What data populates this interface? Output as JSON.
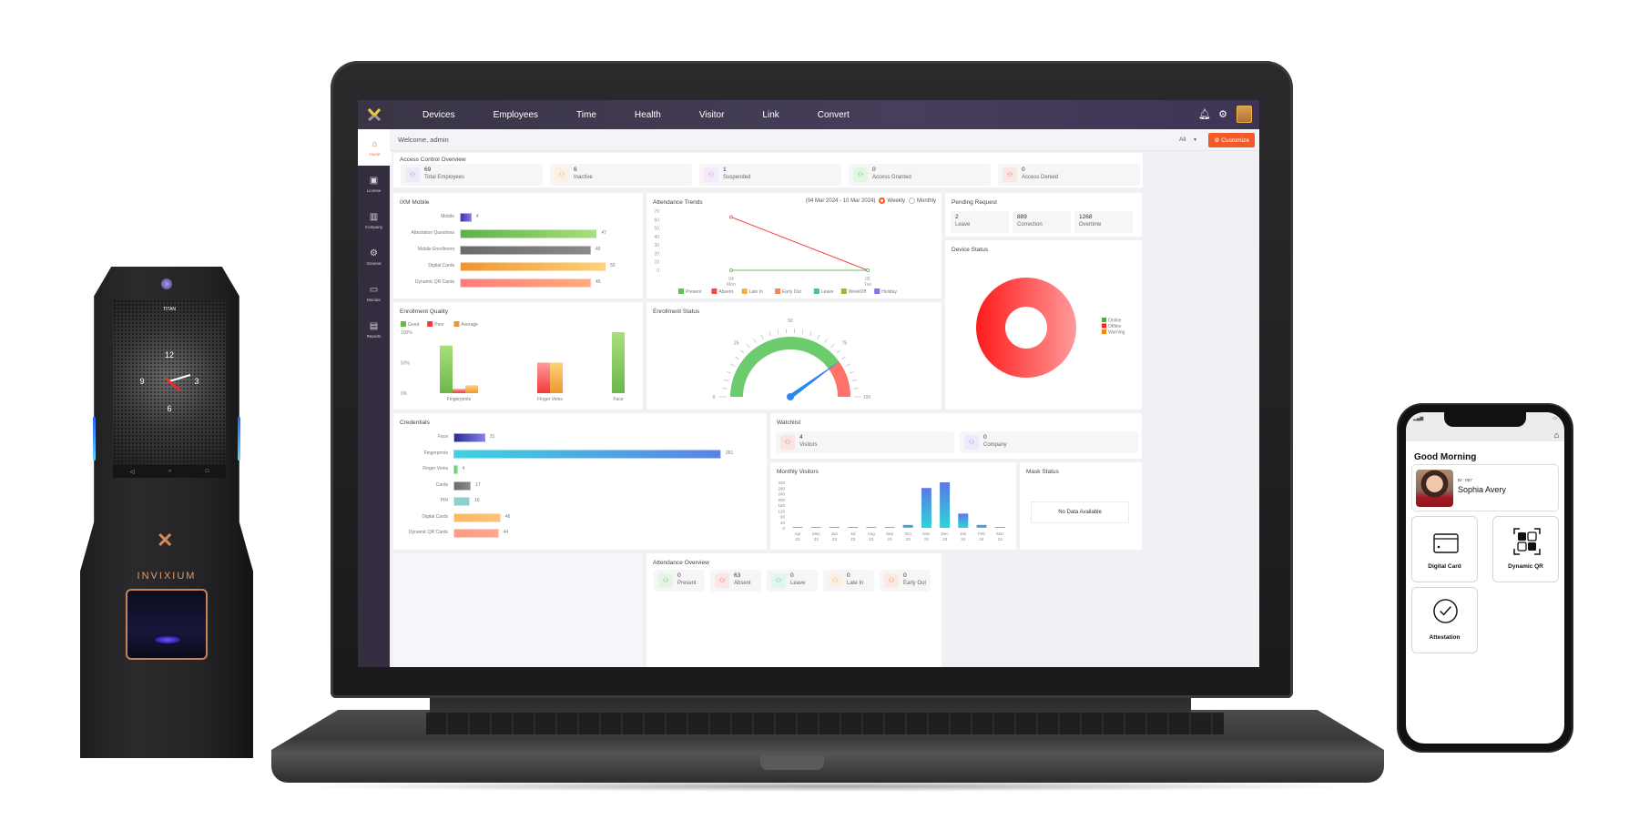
{
  "device": {
    "screen_title": "TITAN",
    "brand": "INVIXIUM",
    "clock_numbers": [
      "12",
      "3",
      "6",
      "9"
    ]
  },
  "app": {
    "nav": {
      "items": [
        "Devices",
        "Employees",
        "Time",
        "Health",
        "Visitor",
        "Link",
        "Convert"
      ],
      "icons": [
        "bell-icon",
        "gear-icon",
        "avatar"
      ]
    },
    "sidebar": {
      "items": [
        {
          "label": "Home",
          "icon": "home-icon",
          "glyph": "⌂",
          "active": true
        },
        {
          "label": "License",
          "icon": "license-icon",
          "glyph": "▣"
        },
        {
          "label": "Company",
          "icon": "company-icon",
          "glyph": "▥"
        },
        {
          "label": "General",
          "icon": "gear-icon",
          "glyph": "⚙"
        },
        {
          "label": "Monitor",
          "icon": "monitor-icon",
          "glyph": "▭"
        },
        {
          "label": "Reports",
          "icon": "reports-icon",
          "glyph": "▤"
        }
      ]
    },
    "header": {
      "welcome": "Welcome, admin",
      "filter_value": "All",
      "customize_label": "Customize"
    },
    "access_control": {
      "title": "Access Control Overview",
      "stats": [
        {
          "value": "69",
          "label": "Total Employees",
          "color": "#8e7cf0",
          "bg": "#ecebfb"
        },
        {
          "value": "6",
          "label": "Inactive",
          "color": "#f2a04a",
          "bg": "#fdf0e2"
        },
        {
          "value": "1",
          "label": "Suspended",
          "color": "#c47be0",
          "bg": "#f6e9fb"
        },
        {
          "value": "0",
          "label": "Access Granted",
          "color": "#4cb85a",
          "bg": "#e3f6e4"
        },
        {
          "value": "0",
          "label": "Access Denied",
          "color": "#ee5a5a",
          "bg": "#fde5e5"
        }
      ]
    },
    "pending_request": {
      "title": "Pending Request",
      "items": [
        {
          "value": "2",
          "label": "Leave"
        },
        {
          "value": "889",
          "label": "Correction"
        },
        {
          "value": "1268",
          "label": "Overtime"
        }
      ]
    },
    "watchlist": {
      "title": "Watchlist",
      "items": [
        {
          "value": "4",
          "label": "Visitors",
          "color": "#ee6a6a",
          "bg": "#fde2e2"
        },
        {
          "value": "0",
          "label": "Company",
          "color": "#8e7cf0",
          "bg": "#ecebfb"
        }
      ]
    },
    "mask_status": {
      "title": "Mask Status",
      "empty_text": "No Data Available"
    },
    "attendance_overview": {
      "title": "Attendance Overview",
      "items": [
        {
          "value": "0",
          "label": "Present",
          "color": "#4cb85a",
          "bg": "#e3f6e4"
        },
        {
          "value": "63",
          "label": "Absent",
          "color": "#ee5a5a",
          "bg": "#fde5e5"
        },
        {
          "value": "0",
          "label": "Leave",
          "color": "#3cc3a0",
          "bg": "#e0f6ef"
        },
        {
          "value": "0",
          "label": "Late In",
          "color": "#f2a04a",
          "bg": "#fdf0e2"
        },
        {
          "value": "0",
          "label": "Early Out",
          "color": "#f07a4a",
          "bg": "#fde9e0"
        }
      ]
    },
    "attendance_trends": {
      "date_range": "(04 Mar 2024 - 10 Mar 2024)",
      "radio_weekly": "Weekly",
      "radio_monthly": "Monthly",
      "selected": "Weekly"
    }
  },
  "phone": {
    "greeting": "Good Morning",
    "user_id": "ID : 007",
    "user_name": "Sophia Avery",
    "tiles": [
      {
        "label": "Digital Card",
        "icon": "card-icon",
        "glyph": "▭"
      },
      {
        "label": "Dynamic QR",
        "icon": "qr-icon",
        "glyph": "⊞"
      },
      {
        "label": "Attestation",
        "icon": "check-circle-icon",
        "glyph": "✓"
      }
    ]
  },
  "chart_data": [
    {
      "id": "ixm_mobile",
      "type": "bar",
      "orientation": "horizontal",
      "title": "IXM Mobile",
      "categories": [
        "Mobile",
        "Attestation Questions",
        "Mobile Enrollment",
        "Digital Cards",
        "Dynamic QR Cards"
      ],
      "values": [
        4,
        47,
        45,
        50,
        45
      ],
      "colors": [
        [
          "#3a37a8",
          "#7b78e8"
        ],
        [
          "#5db04a",
          "#a8e07a"
        ],
        [
          "#6b6b6b",
          "#8a8a8a"
        ],
        [
          "#ef9630",
          "#fdd27a"
        ],
        [
          "#ff7b7b",
          "#ffad7a"
        ]
      ],
      "xlim": [
        0,
        50
      ]
    },
    {
      "id": "attendance_trends",
      "type": "line",
      "title": "Attendance Trends",
      "x": [
        "04\nMon",
        "05\nTue"
      ],
      "x_top": [
        "04",
        "05"
      ],
      "x_bottom": [
        "Mon",
        "Tue"
      ],
      "yticks": [
        0,
        10,
        20,
        30,
        40,
        50,
        60,
        70
      ],
      "ylim": [
        0,
        70
      ],
      "series": [
        {
          "name": "Present",
          "color": "#5cc55c",
          "values": [
            0,
            0
          ]
        },
        {
          "name": "Absent",
          "color": "#f24a4a",
          "values": [
            63,
            0
          ]
        },
        {
          "name": "Late In",
          "color": "#f7ae3a",
          "values": [
            0,
            0
          ]
        },
        {
          "name": "Early Out",
          "color": "#f58a52",
          "values": [
            0,
            0
          ]
        },
        {
          "name": "Leave",
          "color": "#3cc3a0",
          "values": [
            0,
            0
          ]
        },
        {
          "name": "WeekOff",
          "color": "#b3b02a",
          "values": [
            0,
            0
          ]
        },
        {
          "name": "Holiday",
          "color": "#7d74ee",
          "values": [
            0,
            0
          ]
        }
      ],
      "legend": "bottom"
    },
    {
      "id": "device_status",
      "type": "pie",
      "subtype": "donut",
      "title": "Device Status",
      "categories": [
        "Online",
        "Offline",
        "Warning"
      ],
      "values": [
        0,
        100,
        0
      ],
      "colors": [
        "#4caf30",
        "#ff2020",
        "#ef8a10"
      ],
      "legend": "right"
    },
    {
      "id": "enrollment_quality",
      "type": "bar",
      "title": "Enrollment Quality",
      "categories": [
        "Fingerprints",
        "Finger Veins",
        "Face"
      ],
      "series": [
        {
          "name": "Good",
          "color": "#6ab84a",
          "values": [
            78,
            0,
            100
          ]
        },
        {
          "name": "Poor",
          "color": "#f23a3a",
          "values": [
            7,
            50,
            0
          ]
        },
        {
          "name": "Average",
          "color": "#ef9630",
          "values": [
            13,
            50,
            0
          ]
        }
      ],
      "yticks": [
        "0%",
        "50%",
        "100%"
      ],
      "ylim": [
        0,
        100
      ],
      "legend": "top-left"
    },
    {
      "id": "enrollment_status",
      "type": "gauge",
      "title": "Enrollment Status",
      "min": 0,
      "max": 100,
      "value": 80,
      "bands": [
        {
          "from": 0,
          "to": 80,
          "color": "#6ccb6c"
        },
        {
          "from": 80,
          "to": 100,
          "color": "#ff726a"
        }
      ],
      "tick_labels": [
        "0",
        "25",
        "50",
        "75",
        "100"
      ],
      "needle_color": "#2e86f0"
    },
    {
      "id": "credentials",
      "type": "bar",
      "orientation": "horizontal",
      "title": "Credentials",
      "categories": [
        "Face",
        "Fingerprints",
        "Finger Veins",
        "Cards",
        "PIN",
        "Digital Cards",
        "Dynamic QR Cards"
      ],
      "values": [
        31,
        261,
        4,
        17,
        16,
        46,
        44
      ],
      "colors": [
        [
          "#2d2a93",
          "#8480ea"
        ],
        [
          "#3fd2df",
          "#5b83e6"
        ],
        [
          "#58c458",
          "#8ee08e"
        ],
        [
          "#6b6b6b",
          "#8a8a8a"
        ],
        [
          "#8ecfcf",
          "#8ecfcf"
        ],
        [
          "#fdb863",
          "#fdc27a"
        ],
        [
          "#ff9a86",
          "#ffa88e"
        ]
      ],
      "xlim": [
        0,
        261
      ]
    },
    {
      "id": "monthly_visitors",
      "type": "bar",
      "title": "Monthly Visitors",
      "categories": [
        "Apr 23",
        "May 23",
        "Jun 23",
        "Jul 23",
        "Aug 23",
        "Sep 23",
        "Oct 23",
        "Nov 23",
        "Dec 23",
        "Jan 24",
        "Feb 24",
        "Mar 24"
      ],
      "values": [
        0,
        0,
        0,
        0,
        0,
        0,
        20,
        280,
        320,
        100,
        20,
        0
      ],
      "yticks": [
        0,
        40,
        80,
        120,
        160,
        200,
        240,
        280,
        320
      ],
      "ylim": [
        0,
        320
      ],
      "colors": [
        "#2fd3dc",
        "#5a78e4"
      ]
    }
  ]
}
